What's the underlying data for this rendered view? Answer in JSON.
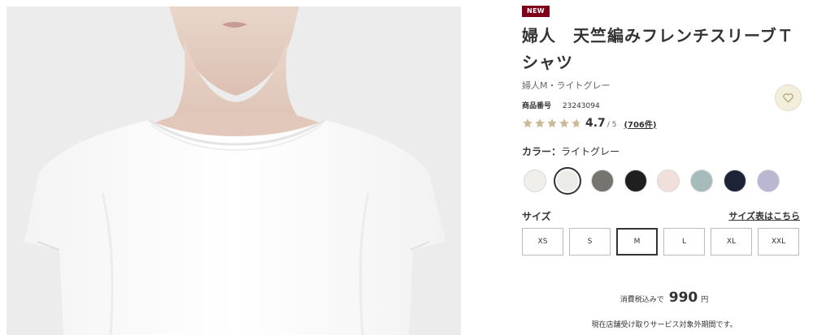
{
  "product": {
    "badge": "NEW",
    "title": "婦人　天竺編みフレンチスリーブＴシャツ",
    "subtitle": "婦人M・ライトグレー",
    "code_label": "商品番号",
    "code_value": "23243094",
    "rating_value": "4.7",
    "rating_max": "/ 5",
    "rating_count": "(706件)",
    "rating_stars": 4.7,
    "favorite_icon": "heart-icon"
  },
  "color": {
    "label": "カラー：",
    "selected": "ライトグレー",
    "swatches": [
      {
        "name": "off-white",
        "hex": "#f1efec"
      },
      {
        "name": "light-gray",
        "hex": "#ebebe7"
      },
      {
        "name": "gray",
        "hex": "#77746f"
      },
      {
        "name": "black",
        "hex": "#1f1f1f"
      },
      {
        "name": "pink",
        "hex": "#f1dfdc"
      },
      {
        "name": "sage",
        "hex": "#a5bcbb"
      },
      {
        "name": "navy",
        "hex": "#1d2438"
      },
      {
        "name": "lavender",
        "hex": "#b9b7d2"
      }
    ]
  },
  "size": {
    "label": "サイズ",
    "guide_link": "サイズ表はこちら",
    "options": [
      "XS",
      "S",
      "M",
      "L",
      "XL",
      "XXL"
    ],
    "selected": "M"
  },
  "price": {
    "prefix": "消費税込みで",
    "amount": "990",
    "unit": "円",
    "notice": "現在店舗受け取りサービス対象外期間です。"
  },
  "colors": {
    "badge": "#7f0019",
    "star": "#c9b994",
    "background": "#ececec"
  }
}
